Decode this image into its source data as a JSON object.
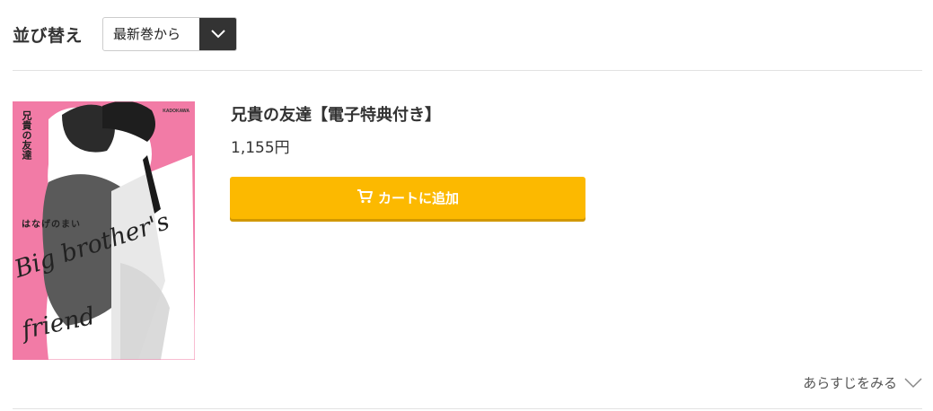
{
  "sort": {
    "label": "並び替え",
    "selected": "最新巻から"
  },
  "product": {
    "title": "兄貴の友達【電子特典付き】",
    "price": "1,155円",
    "cart_label": "カートに追加",
    "cover": {
      "title_vertical": "兄貴の友達",
      "author": "はなげのまい",
      "publisher": "KADOKAWA",
      "script_title": [
        "Big brother's",
        "friend"
      ]
    }
  },
  "synopsis_label": "あらすじをみる",
  "colors": {
    "accent": "#fcb900",
    "cover_pink": "#f27ba6",
    "dark": "#333333"
  }
}
